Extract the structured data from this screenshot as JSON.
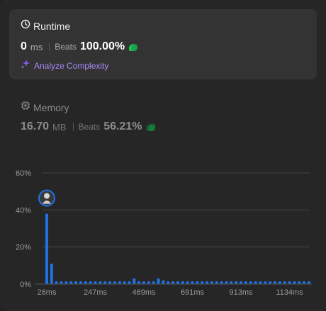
{
  "runtime": {
    "title": "Runtime",
    "value": "0",
    "unit": "ms",
    "beats_label": "Beats",
    "beats_pct": "100.00%",
    "icon": "clock-icon",
    "clap_color": "#22c55e"
  },
  "analyze": {
    "label": "Analyze Complexity",
    "icon": "sparkle-icon",
    "color": "#a78bfa"
  },
  "memory": {
    "title": "Memory",
    "value": "16.70",
    "unit": "MB",
    "beats_label": "Beats",
    "beats_pct": "56.21%",
    "icon": "chip-icon",
    "clap_color": "#15803d"
  },
  "chart_data": {
    "type": "bar",
    "title": "",
    "xlabel": "",
    "ylabel": "",
    "ylim": [
      0,
      60
    ],
    "y_ticks": [
      "60%",
      "40%",
      "20%",
      "0%"
    ],
    "y_tick_values": [
      60,
      40,
      20,
      0
    ],
    "x_tick_labels": [
      "26ms",
      "247ms",
      "469ms",
      "691ms",
      "913ms",
      "1134ms"
    ],
    "x_tick_indices": [
      0,
      10,
      20,
      30,
      40,
      50
    ],
    "values": [
      38,
      11,
      1.5,
      1.5,
      1.5,
      1.5,
      1.5,
      1.5,
      1.5,
      1.5,
      1.5,
      1.5,
      1.5,
      1.5,
      1.5,
      1.5,
      1.5,
      1.5,
      3,
      1.5,
      1.5,
      1.5,
      1.5,
      3,
      2,
      1.5,
      1.5,
      1.5,
      1.5,
      1.5,
      1.5,
      1.5,
      1.5,
      1.5,
      1.5,
      1.5,
      1.5,
      1.5,
      1.5,
      1.5,
      1.5,
      1.5,
      1.5,
      1.5,
      1.5,
      1.5,
      1.5,
      1.5,
      1.5,
      1.5,
      1.5,
      1.5,
      1.5,
      1.5,
      1.5
    ],
    "highlight_index": 0,
    "bar_color": "#1e72e6",
    "grid": true
  }
}
